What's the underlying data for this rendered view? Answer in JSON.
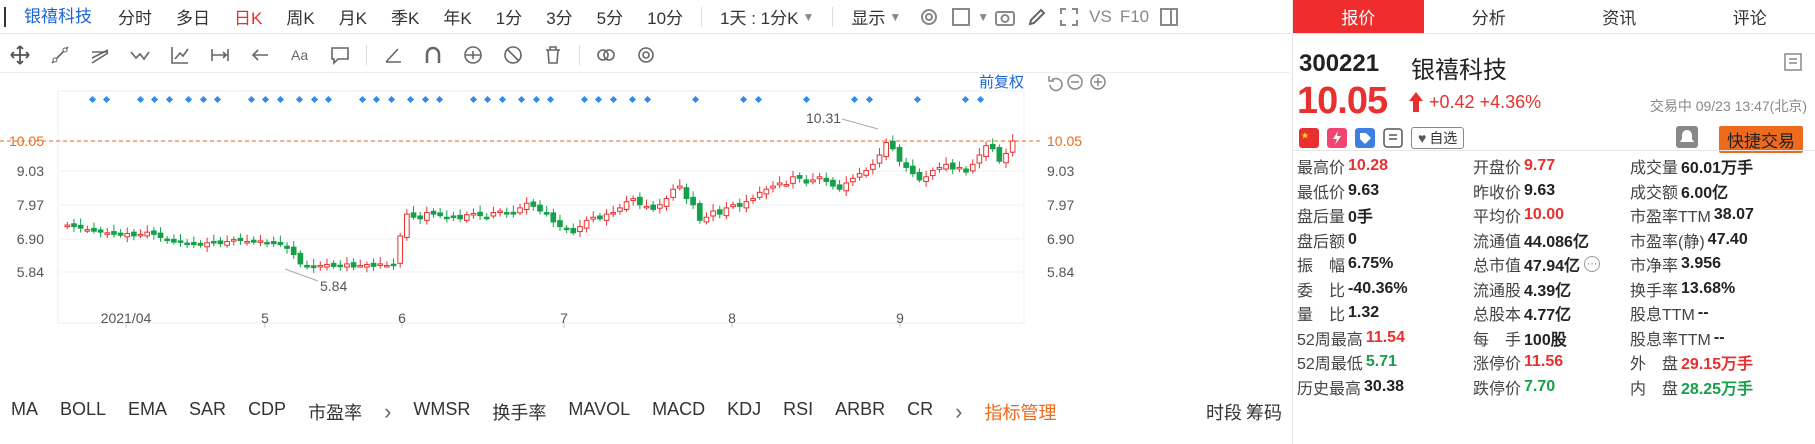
{
  "topbar": {
    "stock_tab": "银禧科技",
    "periods": [
      "分时",
      "多日",
      "日K",
      "周K",
      "月K",
      "季K",
      "年K",
      "1分",
      "3分",
      "5分",
      "10分"
    ],
    "active_period": 2,
    "interval_select": "1天 : 1分K",
    "display_select": "显示",
    "vs_label": "VS",
    "f10_label": "F10"
  },
  "chart": {
    "restore_label": "前复权",
    "price_labels": [
      "10.05",
      "9.03",
      "7.97",
      "6.90",
      "5.84"
    ],
    "high_label": "10.31",
    "low_label": "5.84",
    "x_labels": [
      "2021/04",
      "5",
      "6",
      "7",
      "8",
      "9"
    ],
    "colors": {
      "up": "#e93030",
      "down": "#15a14a",
      "current": "#ee6a1c",
      "marker": "#2d8cf0"
    }
  },
  "chart_data": {
    "type": "candlestick",
    "current_price": 10.05,
    "ylim": [
      5.84,
      10.31
    ],
    "y_ticks": [
      10.05,
      9.03,
      7.97,
      6.9,
      5.84
    ],
    "x_ticks": [
      "2021/04",
      "5",
      "6",
      "7",
      "8",
      "9"
    ],
    "annotations": [
      {
        "text": "10.31",
        "kind": "period-high"
      },
      {
        "text": "5.84",
        "kind": "period-low"
      }
    ],
    "closes": [
      7.35,
      7.3,
      7.25,
      7.2,
      7.15,
      7.12,
      7.1,
      7.05,
      7.02,
      7.08,
      7.0,
      7.05,
      7.12,
      7.05,
      6.95,
      6.85,
      6.8,
      6.82,
      6.75,
      6.72,
      6.7,
      6.78,
      6.8,
      6.75,
      6.82,
      6.88,
      6.85,
      6.82,
      6.8,
      6.84,
      6.78,
      6.75,
      6.72,
      6.6,
      6.4,
      6.1,
      6.0,
      5.98,
      6.05,
      6.08,
      6.02,
      6.05,
      6.1,
      6.0,
      6.05,
      6.08,
      6.02,
      6.1,
      6.05,
      6.08,
      7.0,
      7.7,
      7.6,
      7.55,
      7.75,
      7.7,
      7.65,
      7.6,
      7.62,
      7.55,
      7.68,
      7.72,
      7.65,
      7.6,
      7.75,
      7.8,
      7.72,
      7.7,
      7.9,
      8.05,
      7.95,
      7.8,
      7.7,
      7.45,
      7.3,
      7.2,
      7.1,
      7.3,
      7.5,
      7.6,
      7.55,
      7.7,
      7.75,
      7.9,
      8.1,
      8.2,
      8.0,
      7.95,
      7.85,
      8.0,
      8.2,
      8.5,
      8.6,
      8.2,
      8.0,
      7.5,
      7.6,
      7.8,
      7.7,
      7.9,
      8.0,
      7.95,
      8.1,
      8.2,
      8.4,
      8.5,
      8.6,
      8.7,
      8.65,
      8.9,
      8.85,
      8.7,
      8.8,
      8.9,
      8.75,
      8.6,
      8.5,
      8.7,
      8.85,
      9.0,
      9.1,
      9.3,
      9.6,
      10.0,
      9.8,
      9.4,
      9.2,
      9.0,
      8.8,
      8.9,
      9.1,
      9.2,
      9.3,
      9.15,
      9.2,
      9.05,
      9.3,
      9.6,
      9.9,
      9.8,
      9.4,
      9.65,
      10.05
    ],
    "marker_count": 40
  },
  "indicators": {
    "items": [
      "MA",
      "BOLL",
      "EMA",
      "SAR",
      "CDP",
      "市盈率",
      "›",
      "WMSR",
      "换手率",
      "MAVOL",
      "MACD",
      "KDJ",
      "RSI",
      "ARBR",
      "CR",
      "›"
    ],
    "manage": "指标管理",
    "right": [
      "时段",
      "筹码"
    ]
  },
  "panel": {
    "tabs": [
      "报价",
      "分析",
      "资讯",
      "评论"
    ],
    "code": "300221",
    "name": "银禧科技",
    "price": "10.05",
    "change": "+0.42",
    "change_pct": "+4.36%",
    "trade_status": "交易中 09/23 13:47(北京)",
    "watch_label": "自选",
    "fast_trade": "快捷交易",
    "quotes": [
      [
        [
          "最高价",
          "10.28",
          "red"
        ],
        [
          "开盘价",
          "9.77",
          "red"
        ],
        [
          "成交量",
          "60.01万手",
          ""
        ]
      ],
      [
        [
          "最低价",
          "9.63",
          ""
        ],
        [
          "昨收价",
          "9.63",
          ""
        ],
        [
          "成交额",
          "6.00亿",
          ""
        ]
      ],
      [
        [
          "盘后量",
          "0手",
          ""
        ],
        [
          "平均价",
          "10.00",
          "red"
        ],
        [
          "市盈率TTM",
          "38.07",
          ""
        ]
      ],
      [
        [
          "盘后额",
          "0",
          ""
        ],
        [
          "流通值",
          "44.086亿",
          ""
        ],
        [
          "市盈率(静)",
          "47.40",
          ""
        ]
      ],
      [
        [
          "振　幅",
          "6.75%",
          ""
        ],
        [
          "总市值",
          "47.94亿",
          ""
        ],
        [
          "市净率",
          "3.956",
          ""
        ]
      ],
      [
        [
          "委　比",
          "-40.36%",
          ""
        ],
        [
          "流通股",
          "4.39亿",
          ""
        ],
        [
          "换手率",
          "13.68%",
          ""
        ]
      ],
      [
        [
          "量　比",
          "1.32",
          ""
        ],
        [
          "总股本",
          "4.77亿",
          ""
        ],
        [
          "股息TTM",
          "--",
          ""
        ]
      ],
      [
        [
          "52周最高",
          "11.54",
          "red"
        ],
        [
          "每　手",
          "100股",
          ""
        ],
        [
          "股息率TTM",
          "--",
          ""
        ]
      ],
      [
        [
          "52周最低",
          "5.71",
          "green"
        ],
        [
          "涨停价",
          "11.56",
          "red"
        ],
        [
          "外　盘",
          "29.15万手",
          "red"
        ]
      ],
      [
        [
          "历史最高",
          "30.38",
          ""
        ],
        [
          "跌停价",
          "7.70",
          "green"
        ],
        [
          "内　盘",
          "28.25万手",
          "green"
        ]
      ]
    ]
  }
}
